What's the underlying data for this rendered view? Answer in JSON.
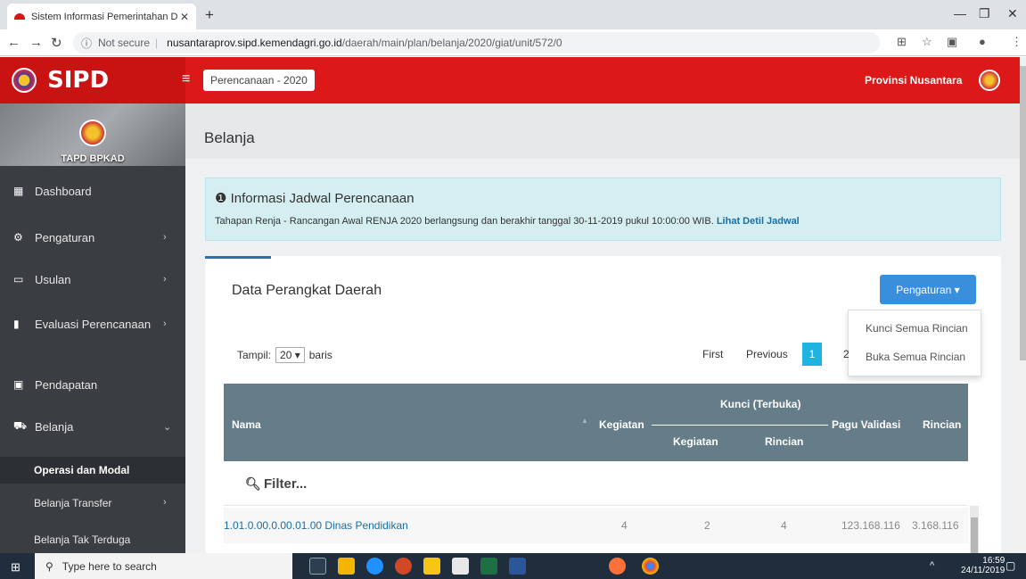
{
  "browser": {
    "tab_title": "Sistem Informasi Pemerintahan D",
    "tab_close": "✕",
    "new_tab": "+",
    "secure_label": "Not secure",
    "url_domain": "nusantaraprov.sipd.kemendagri.go.id",
    "url_path": "/daerah/main/plan/belanja/2020/giat/unit/572/0"
  },
  "header": {
    "app_name": "SIPD",
    "menu_dropdown": "Perencanaan - 2020",
    "province": "Provinsi Nusantara"
  },
  "sidebar": {
    "profile_name": "TAPD BPKAD",
    "items": [
      {
        "label": "Dashboard",
        "icon": "dashboard-icon"
      },
      {
        "label": "Pengaturan",
        "icon": "gear-icon"
      },
      {
        "label": "Usulan",
        "icon": "chat-icon"
      },
      {
        "label": "Evaluasi Perencanaan",
        "icon": "bookmark-icon"
      },
      {
        "label": "Pendapatan",
        "icon": "wallet-icon"
      },
      {
        "label": "Belanja",
        "icon": "cart-icon"
      }
    ],
    "subitems": [
      "Operasi dan Modal",
      "Belanja Transfer",
      "Belanja Tak Terduga"
    ]
  },
  "main": {
    "page_title": "Belanja",
    "alert_title": "Informasi Jadwal Perencanaan",
    "alert_text": "Tahapan Renja - Rancangan Awal RENJA 2020 berlangsung dan berakhir tanggal 30-11-2019 pukul 10:00:00 WIB.",
    "alert_link": "Lihat Detil Jadwal",
    "panel_title": "Data Perangkat Daerah",
    "pengaturan_button": "Pengaturan ▾",
    "dropdown_items": [
      "Kunci Semua Rincian",
      "Buka Semua Rincian"
    ],
    "tampil_label": "Tampil:",
    "tampil_value": "20",
    "baris_label": "baris",
    "pager": {
      "first": "First",
      "previous": "Previous",
      "page1": "1",
      "page2": "2"
    },
    "table": {
      "col_nama": "Nama",
      "col_kegiatan": "Kegiatan",
      "col_kunci": "Kunci (Terbuka)",
      "col_kunci_kegiatan": "Kegiatan",
      "col_kunci_rincian": "Rincian",
      "col_pagu": "Pagu Validasi",
      "col_rincian": "Rincian",
      "filter_placeholder": "Filter...",
      "rows": [
        {
          "nama": "1.01.0.00.0.00.01.00 Dinas Pendidikan",
          "kegiatan": "4",
          "kunci_kegiatan": "2",
          "kunci_rincian": "4",
          "pagu": "123.168.116",
          "rincian": "3.168.116"
        }
      ]
    }
  },
  "taskbar": {
    "search_placeholder": "Type here to search",
    "time": "16:59",
    "date": "24/11/2019"
  }
}
